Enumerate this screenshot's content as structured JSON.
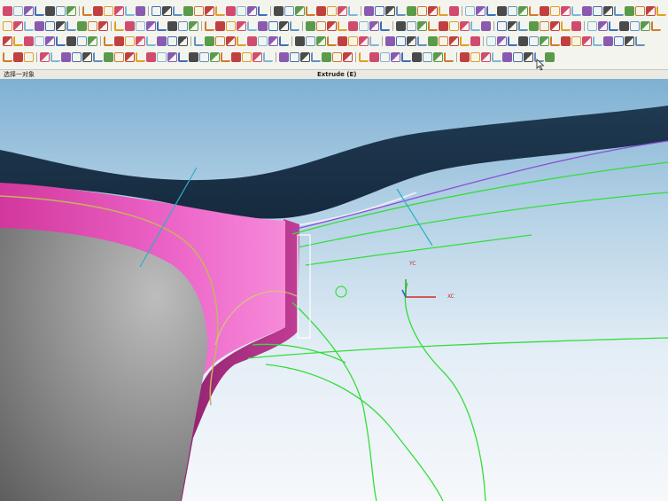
{
  "status_bar": {
    "left_text": "选择一对象",
    "center_text": "Extrude (E)"
  },
  "viewport": {
    "axis_labels": {
      "yc": "YC",
      "xc": "XC"
    }
  },
  "toolbar_colors": [
    "#d14b6e",
    "#3b6fb6",
    "#5a9a4a",
    "#e0a020",
    "#8a5ab0",
    "#5f8fc2",
    "#c04040",
    "#7ab8d8",
    "#4a4a4a",
    "#d07a2a"
  ]
}
